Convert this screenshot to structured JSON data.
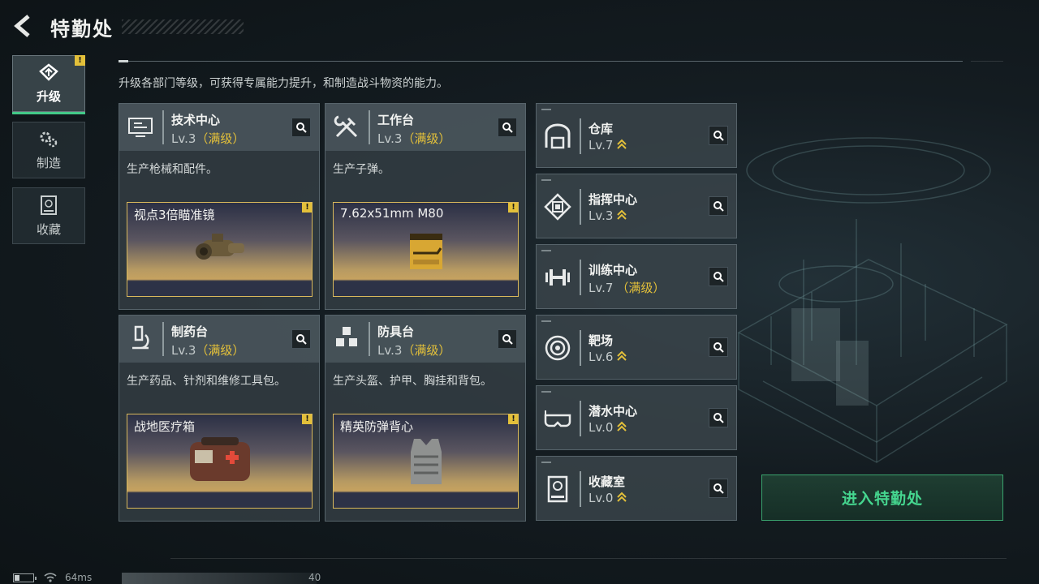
{
  "header": {
    "title": "特勤处"
  },
  "nav": [
    {
      "label": "升级",
      "active": true,
      "alert": "!"
    },
    {
      "label": "制造",
      "active": false
    },
    {
      "label": "收藏",
      "active": false
    }
  ],
  "description": "升级各部门等级，可获得专属能力提升，和制造战斗物资的能力。",
  "cards": [
    {
      "name": "技术中心",
      "level": "Lv.3",
      "max": "（满级）",
      "desc": "生产枪械和配件。",
      "item": "视点3倍瞄准镜",
      "alert": "!"
    },
    {
      "name": "工作台",
      "level": "Lv.3",
      "max": "（满级）",
      "desc": "生产子弹。",
      "item": "7.62x51mm M80",
      "alert": "!"
    },
    {
      "name": "制药台",
      "level": "Lv.3",
      "max": "（满级）",
      "desc": "生产药品、针剂和维修工具包。",
      "item": "战地医疗箱",
      "alert": "!"
    },
    {
      "name": "防具台",
      "level": "Lv.3",
      "max": "（满级）",
      "desc": "生产头盔、护甲、胸挂和背包。",
      "item": "精英防弹背心",
      "alert": "!"
    }
  ],
  "facilities": [
    {
      "name": "仓库",
      "level": "Lv.7",
      "max": "",
      "upgradable": true
    },
    {
      "name": "指挥中心",
      "level": "Lv.3",
      "max": "",
      "upgradable": true
    },
    {
      "name": "训练中心",
      "level": "Lv.7",
      "max": "（满级）",
      "upgradable": false
    },
    {
      "name": "靶场",
      "level": "Lv.6",
      "max": "",
      "upgradable": true
    },
    {
      "name": "潜水中心",
      "level": "Lv.0",
      "max": "",
      "upgradable": true
    },
    {
      "name": "收藏室",
      "level": "Lv.0",
      "max": "",
      "upgradable": true
    }
  ],
  "enter_button": "进入特勤处",
  "status": {
    "ping": "64ms",
    "fps": "40"
  },
  "colors": {
    "accent_green": "#45d68f",
    "max_gold": "#e3c03a",
    "panel": "#343e44"
  }
}
